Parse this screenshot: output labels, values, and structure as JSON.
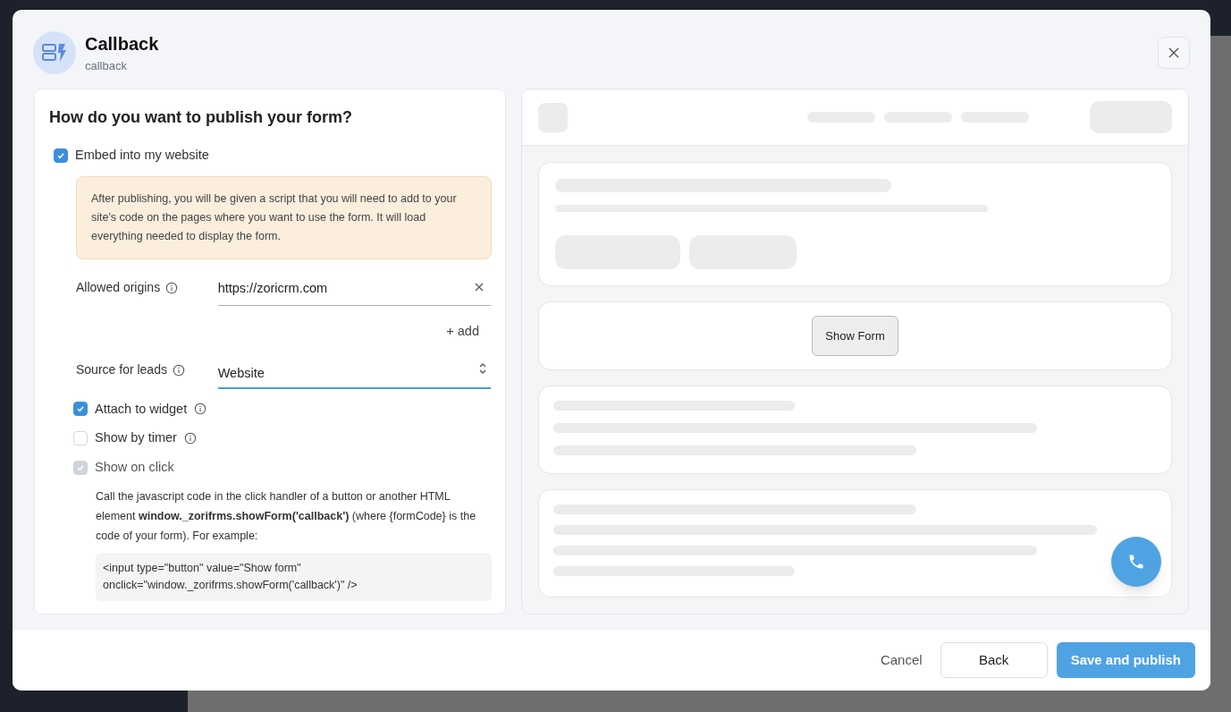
{
  "modal": {
    "title": "Callback",
    "subtitle": "callback"
  },
  "form": {
    "heading": "How do you want to publish your form?",
    "embed": {
      "label": "Embed into my website",
      "checked": true
    },
    "notice": "After publishing, you will be given a script that you will need to add to your site's code on the pages where you want to use the form. It will load everything needed to display the form.",
    "allowed_origins": {
      "label": "Allowed origins",
      "value": "https://zoricrm.com",
      "add": "+ add"
    },
    "source": {
      "label": "Source for leads",
      "value": "Website"
    },
    "options": [
      {
        "label": "Attach to widget",
        "checked": true,
        "disabled": false,
        "info": true
      },
      {
        "label": "Show by timer",
        "checked": false,
        "disabled": false,
        "info": true
      },
      {
        "label": "Show on click",
        "checked": true,
        "disabled": true,
        "info": false
      }
    ],
    "help": "Call the javascript code in the click handler of a button or another HTML element **window._zorifrms.showForm('callback')** (where {formCode} is the code of your form). For example:",
    "code": [
      "<input type=\"button\" value=\"Show form\"",
      "onclick=\"window._zorifrms.showForm('callback')\" />"
    ]
  },
  "preview": {
    "button": "Show Form"
  },
  "footer": {
    "buttons": [
      {
        "label": "Cancel",
        "kind": "text"
      },
      {
        "label": "Back",
        "kind": "outline"
      },
      {
        "label": "Save and publish",
        "kind": "primary"
      }
    ]
  }
}
